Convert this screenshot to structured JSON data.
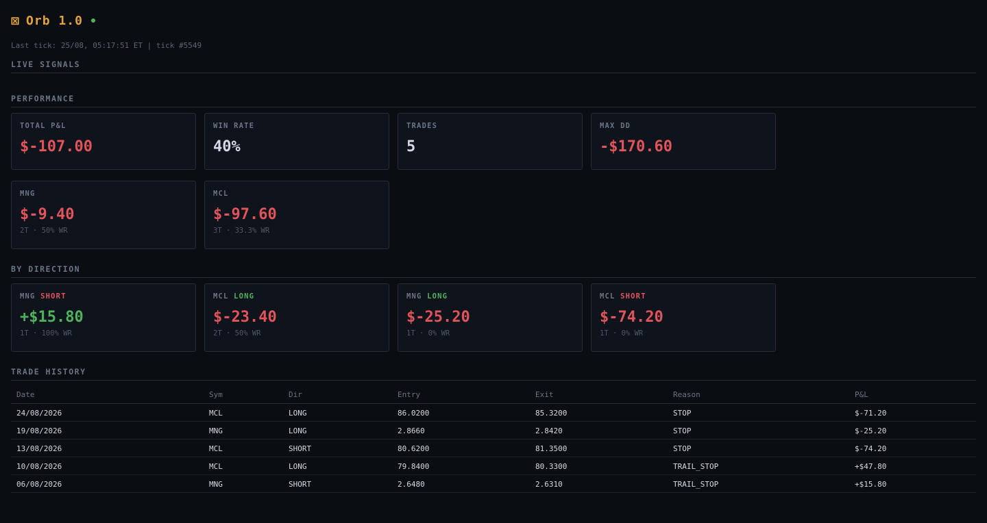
{
  "app": {
    "logo_icon": "⊠",
    "title": "Orb 1.0",
    "status_color": "#4fb35c",
    "tick_line": "Last tick: 25/08, 05:17:51 ET | tick #5549"
  },
  "sections": {
    "live_signals": "LIVE SIGNALS",
    "performance": "PERFORMANCE",
    "by_direction": "BY DIRECTION",
    "trade_history": "TRADE HISTORY"
  },
  "performance": {
    "summary": [
      {
        "label": "TOTAL P&L",
        "value": "$-107.00",
        "tone": "neg"
      },
      {
        "label": "WIN RATE",
        "value": "40%",
        "tone": "neutral"
      },
      {
        "label": "TRADES",
        "value": "5",
        "tone": "neutral"
      },
      {
        "label": "MAX DD",
        "value": "-$170.60",
        "tone": "neg"
      }
    ],
    "by_symbol": [
      {
        "label": "MNG",
        "value": "$-9.40",
        "sub": "2T · 50% WR",
        "tone": "neg"
      },
      {
        "label": "MCL",
        "value": "$-97.60",
        "sub": "3T · 33.3% WR",
        "tone": "neg"
      }
    ]
  },
  "by_direction": [
    {
      "sym": "MNG",
      "dir": "SHORT",
      "value": "+$15.80",
      "sub": "1T · 100% WR",
      "tone": "pos"
    },
    {
      "sym": "MCL",
      "dir": "LONG",
      "value": "$-23.40",
      "sub": "2T · 50% WR",
      "tone": "neg"
    },
    {
      "sym": "MNG",
      "dir": "LONG",
      "value": "$-25.20",
      "sub": "1T · 0% WR",
      "tone": "neg"
    },
    {
      "sym": "MCL",
      "dir": "SHORT",
      "value": "$-74.20",
      "sub": "1T · 0% WR",
      "tone": "neg"
    }
  ],
  "history": {
    "columns": [
      "Date",
      "Sym",
      "Dir",
      "Entry",
      "Exit",
      "Reason",
      "P&L"
    ],
    "rows": [
      {
        "date": "24/08/2026",
        "sym": "MCL",
        "dir": "LONG",
        "entry": "86.0200",
        "exit": "85.3200",
        "reason": "STOP",
        "pnl": "$-71.20",
        "tone": "neg"
      },
      {
        "date": "19/08/2026",
        "sym": "MNG",
        "dir": "LONG",
        "entry": "2.8660",
        "exit": "2.8420",
        "reason": "STOP",
        "pnl": "$-25.20",
        "tone": "neg"
      },
      {
        "date": "13/08/2026",
        "sym": "MCL",
        "dir": "SHORT",
        "entry": "80.6200",
        "exit": "81.3500",
        "reason": "STOP",
        "pnl": "$-74.20",
        "tone": "neg"
      },
      {
        "date": "10/08/2026",
        "sym": "MCL",
        "dir": "LONG",
        "entry": "79.8400",
        "exit": "80.3300",
        "reason": "TRAIL_STOP",
        "pnl": "+$47.80",
        "tone": "pos"
      },
      {
        "date": "06/08/2026",
        "sym": "MNG",
        "dir": "SHORT",
        "entry": "2.6480",
        "exit": "2.6310",
        "reason": "TRAIL_STOP",
        "pnl": "+$15.80",
        "tone": "pos"
      }
    ]
  }
}
